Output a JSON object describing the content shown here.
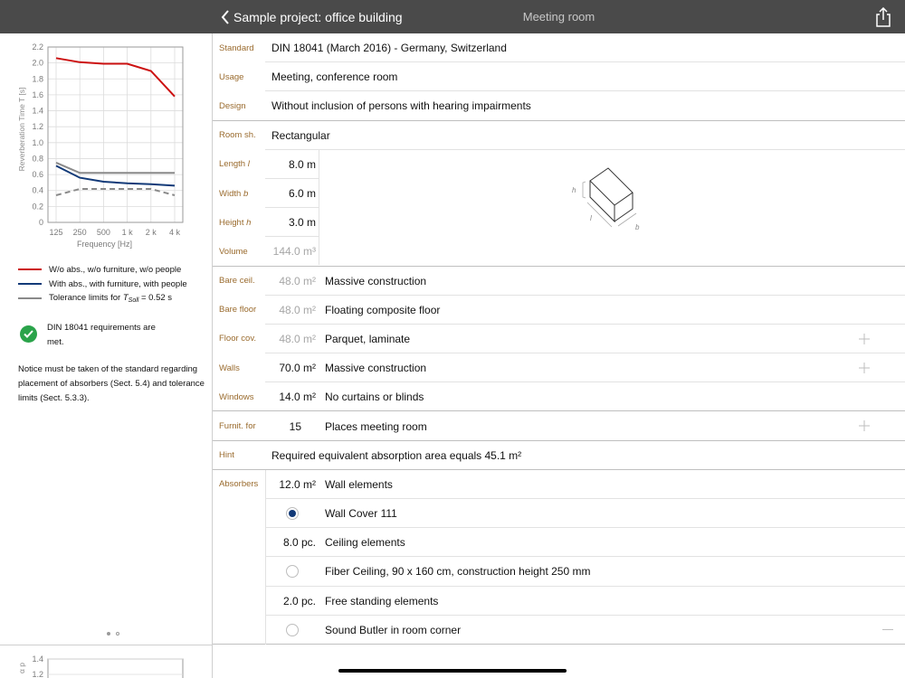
{
  "topbar": {
    "back_label": "Sample project: office building",
    "title": "Meeting room"
  },
  "chart_data": {
    "type": "line",
    "x": [
      "125",
      "250",
      "500",
      "1 k",
      "2 k",
      "4 k"
    ],
    "xlabel": "Frequency [Hz]",
    "ylabel": "Reverberation Time T [s]",
    "yticks": [
      "0",
      "0.2",
      "0.4",
      "0.6",
      "0.8",
      "1.0",
      "1.2",
      "1.4",
      "1.6",
      "1.8",
      "2.0",
      "2.2"
    ],
    "ylim": [
      0,
      2.2
    ],
    "grid": true,
    "series": [
      {
        "name": "W/o abs., w/o furniture, w/o people",
        "color": "#cc1111",
        "style": "solid",
        "values": [
          2.06,
          2.01,
          1.99,
          1.99,
          1.9,
          1.58
        ]
      },
      {
        "name": "With abs., with furniture, with people",
        "color": "#123a78",
        "style": "solid",
        "values": [
          0.71,
          0.56,
          0.51,
          0.49,
          0.48,
          0.46
        ]
      },
      {
        "name": "Tolerance limits for T_Soll = 0.52 s",
        "color": "#8a8a8a",
        "style": "solid",
        "values": [
          0.75,
          0.62,
          0.62,
          0.62,
          0.62,
          0.62
        ]
      },
      {
        "name": "",
        "color": "#8a8a8a",
        "style": "dashed",
        "values": [
          0.34,
          0.42,
          0.42,
          0.42,
          0.42,
          0.34
        ]
      }
    ]
  },
  "legend": {
    "item1": "W/o abs., w/o furniture, w/o people",
    "item2": "With abs., with furniture, with people",
    "item3_pre": "Tolerance limits for ",
    "item3_T": "T",
    "item3_sub": "Soll",
    "item3_post": " = 0.52 s"
  },
  "status": {
    "requirements": "DIN 18041 requirements are met.",
    "notice": "Notice must be taken of the standard regarding placement of absorbers (Sect. 5.4) and tolerance limits (Sect. 5.3.3)."
  },
  "chart2": {
    "yticks": [
      "1.4",
      "1.2"
    ],
    "ylabel_fragment": "α p"
  },
  "colors": {
    "label": "#9a6b2e",
    "accent": "#123a78",
    "check": "#2aa34a"
  },
  "form": {
    "standard": {
      "label": "Standard",
      "value": "DIN 18041 (March 2016) - Germany, Switzerland"
    },
    "usage": {
      "label": "Usage",
      "value": "Meeting, conference room"
    },
    "design": {
      "label": "Design",
      "value": "Without inclusion of persons with hearing impairments"
    },
    "room_shape": {
      "label": "Room sh.",
      "value": "Rectangular"
    },
    "length": {
      "label_pre": "Length ",
      "label_var": "l",
      "value": "8.0 m"
    },
    "width": {
      "label_pre": "Width ",
      "label_var": "b",
      "value": "6.0 m"
    },
    "height": {
      "label_pre": "Height ",
      "label_var": "h",
      "value": "3.0 m"
    },
    "volume": {
      "label": "Volume",
      "value": "144.0 m³"
    },
    "diagram": {
      "h": "h",
      "l": "l",
      "b": "b"
    },
    "bare_ceiling": {
      "label": "Bare ceil.",
      "value": "48.0 m²",
      "desc": "Massive construction"
    },
    "bare_floor": {
      "label": "Bare floor",
      "value": "48.0 m²",
      "desc": "Floating composite floor"
    },
    "floor_cov": {
      "label": "Floor cov.",
      "value": "48.0 m²",
      "desc": "Parquet, laminate"
    },
    "walls": {
      "label": "Walls",
      "value": "70.0 m²",
      "desc": "Massive construction"
    },
    "windows": {
      "label": "Windows",
      "value": "14.0 m²",
      "desc": "No curtains or blinds"
    },
    "furniture": {
      "label": "Furnit. for",
      "value": "15",
      "desc": "Places meeting room"
    },
    "hint": {
      "label": "Hint",
      "value": "Required equivalent absorption area equals 45.1 m²"
    },
    "absorbers": {
      "label": "Absorbers",
      "groups": [
        {
          "amount": "12.0 m²",
          "name": "Wall elements",
          "option": "Wall Cover 111",
          "selected": true
        },
        {
          "amount": "8.0 pc.",
          "name": "Ceiling elements",
          "option": "Fiber Ceiling, 90 x 160 cm, construction height 250 mm",
          "selected": false
        },
        {
          "amount": "2.0 pc.",
          "name": "Free standing elements",
          "option": "Sound Butler in room corner",
          "selected": false
        }
      ]
    }
  }
}
